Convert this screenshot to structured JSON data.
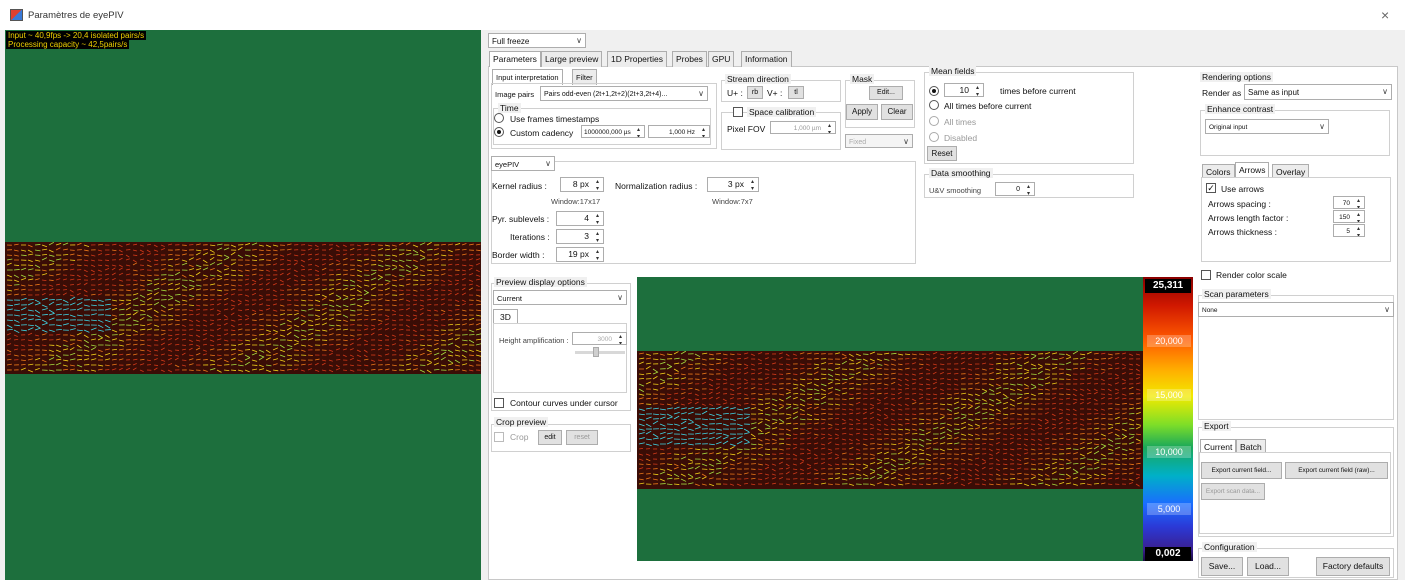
{
  "window": {
    "title": "Paramètres de eyePIV",
    "close": "×"
  },
  "overlay": {
    "input_line": "Input ~ 40,9fps -> 20,4 isolated pairs/s",
    "capacity_line": "Processing capacity ~ 42,5pairs/s"
  },
  "freeze_select": "Full freeze",
  "main_tabs": [
    "Parameters",
    "Large preview",
    "1D Properties",
    "Probes",
    "GPU",
    "Information"
  ],
  "input_tabs": [
    "Input interpretation",
    "Filter"
  ],
  "image_pairs": {
    "label": "Image pairs",
    "value": "Pairs odd-even (2t+1,2t+2)(2t+3,2t+4)..."
  },
  "time": {
    "title": "Time",
    "use_frames": "Use frames timestamps",
    "custom_cadency": "Custom cadency",
    "cadency_us": "1000000,000 µs",
    "cadency_hz": "1,000 Hz"
  },
  "stream_direction": {
    "title": "Stream direction",
    "u_label": "U+ :",
    "u_value": "rb",
    "v_label": "V+ :",
    "v_value": "tl"
  },
  "space_calibration": {
    "label": "Space calibration",
    "fov_label": "Pixel FOV",
    "fov_value": "1,000 µm",
    "unit_select": "Fixed"
  },
  "mask": {
    "title": "Mask",
    "edit": "Edit...",
    "apply": "Apply",
    "clear": "Clear"
  },
  "mean_fields": {
    "title": "Mean fields",
    "times_value": "10",
    "times_label": "times before current",
    "all_before": "All times before current",
    "all_times": "All times",
    "disabled": "Disabled",
    "reset": "Reset"
  },
  "algorithm": {
    "select": "eyePIV",
    "kernel_label": "Kernel radius :",
    "kernel_value": "8 px",
    "kernel_window": "Window:17x17",
    "norm_label": "Normalization radius :",
    "norm_value": "3 px",
    "norm_window": "Window:7x7",
    "sublevels_label": "Pyr. sublevels :",
    "sublevels_value": "4",
    "iterations_label": "Iterations :",
    "iterations_value": "3",
    "border_label": "Border width :",
    "border_value": "19 px"
  },
  "data_smoothing": {
    "title": "Data smoothing",
    "label": "U&V smoothing",
    "value": "0"
  },
  "preview_options": {
    "title": "Preview display options",
    "select": "Current",
    "tab": "3D",
    "height_label": "Height amplification :",
    "height_value": "3000",
    "contour": "Contour curves under cursor"
  },
  "crop_preview": {
    "title": "Crop preview",
    "crop": "Crop",
    "edit": "edit",
    "reset": "reset"
  },
  "rendering": {
    "title": "Rendering options",
    "render_label": "Render as",
    "render_value": "Same as input",
    "enhance_title": "Enhance contrast",
    "enhance_value": "Original input"
  },
  "arrows": {
    "tabs": [
      "Colors",
      "Arrows",
      "Overlay"
    ],
    "use_arrows": "Use arrows",
    "spacing_label": "Arrows spacing :",
    "spacing_value": "70",
    "length_label": "Arrows length factor :",
    "length_value": "150",
    "thickness_label": "Arrows thickness :",
    "thickness_value": "5"
  },
  "render_scale": "Render color scale",
  "scan": {
    "title": "Scan parameters",
    "select": "None"
  },
  "export": {
    "title": "Export",
    "tabs": [
      "Current",
      "Batch"
    ],
    "current_field": "Export current field...",
    "current_field_raw": "Export current field (raw)...",
    "scan_data": "Export scan data..."
  },
  "configuration": {
    "title": "Configuration",
    "save": "Save...",
    "load": "Load...",
    "factory": "Factory defaults"
  },
  "color_scale": {
    "max": "25,311",
    "ticks": [
      "20,000",
      "15,000",
      "10,000",
      "5,000"
    ],
    "min": "0,002"
  },
  "colors": {
    "field_background": "#1d6f3d",
    "flow_band": "#3a0d06",
    "status_text": "#f0d000"
  }
}
